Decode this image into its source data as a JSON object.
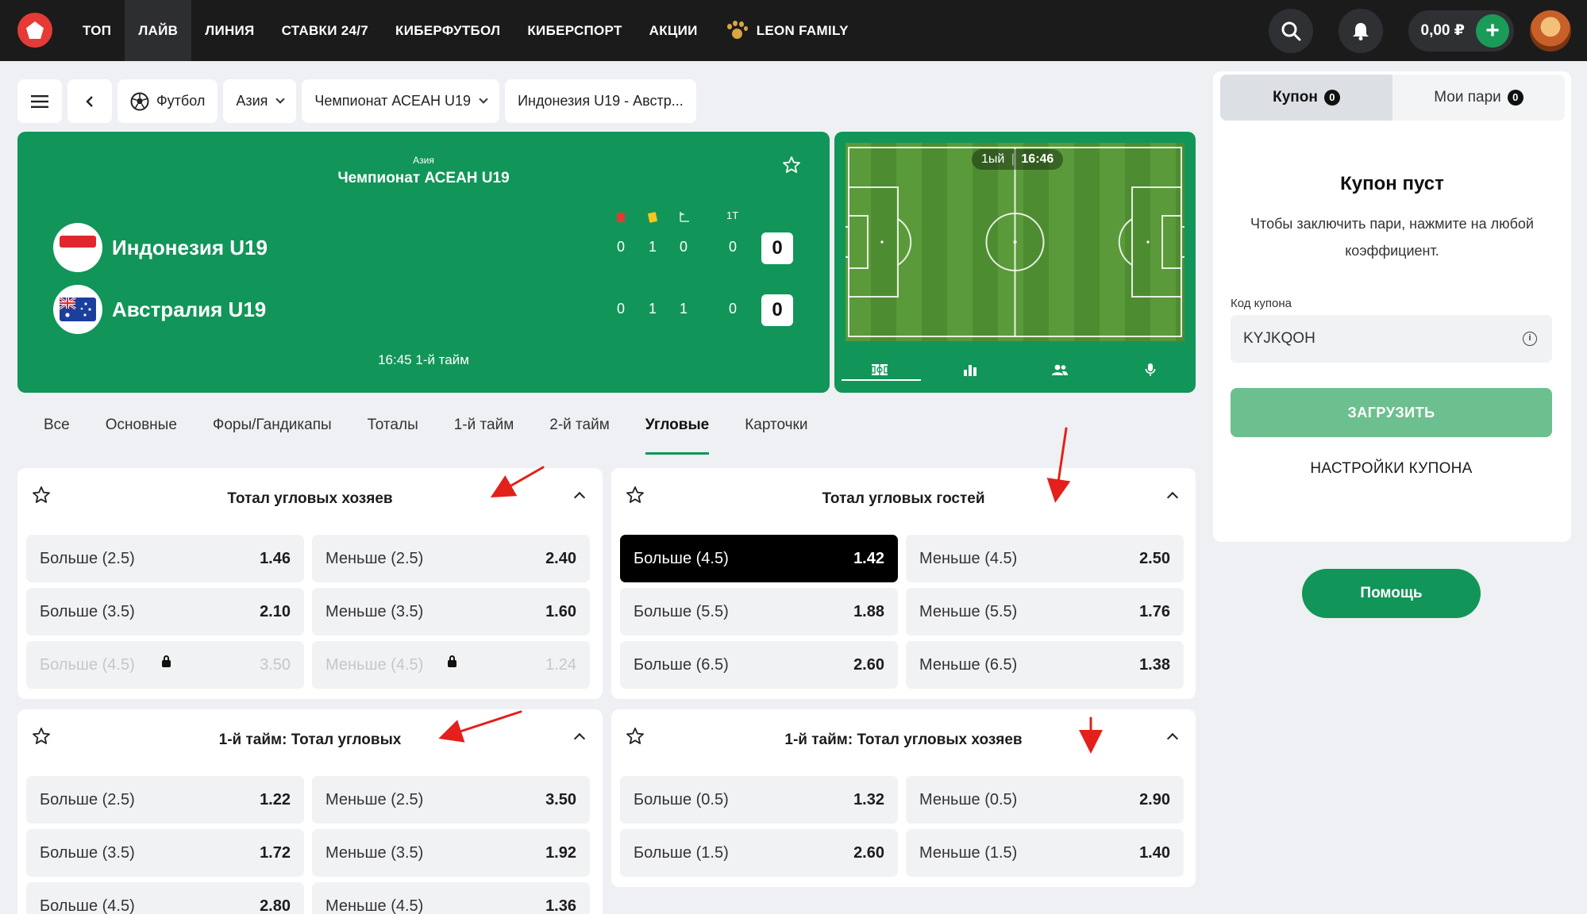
{
  "nav": {
    "items": [
      "ТОП",
      "ЛАЙВ",
      "ЛИНИЯ",
      "СТАВКИ 24/7",
      "КИБЕРФУТБОЛ",
      "КИБЕРСПОРТ",
      "АКЦИИ"
    ],
    "family": "LEON FAMILY",
    "balance": "0,00 ₽"
  },
  "breadcrumb": {
    "sport": "Футбол",
    "region": "Азия",
    "league": "Чемпионат АСЕАН U19",
    "match": "Индонезия U19 - Австр..."
  },
  "match": {
    "region": "Азия",
    "league": "Чемпионат АСЕАН U19",
    "stat_half_label": "1Т",
    "home": {
      "name": "Индонезия U19",
      "red": "0",
      "yellow": "1",
      "corners": "0",
      "half": "0",
      "total": "0"
    },
    "away": {
      "name": "Австралия U19",
      "red": "0",
      "yellow": "1",
      "corners": "1",
      "half": "0",
      "total": "0"
    },
    "time": "16:45 1-й тайм"
  },
  "pitch": {
    "period": "1ый",
    "clock": "16:46"
  },
  "market_tabs": [
    "Все",
    "Основные",
    "Форы/Гандикапы",
    "Тоталы",
    "1-й тайм",
    "2-й тайм",
    "Угловые",
    "Карточки"
  ],
  "markets": [
    {
      "title": "Тотал угловых хозяев",
      "rows": [
        {
          "over": "Больше (2.5)",
          "over_odd": "1.46",
          "under": "Меньше (2.5)",
          "under_odd": "2.40"
        },
        {
          "over": "Больше (3.5)",
          "over_odd": "2.10",
          "under": "Меньше (3.5)",
          "under_odd": "1.60"
        },
        {
          "over": "Больше (4.5)",
          "over_odd": "3.50",
          "under": "Меньше (4.5)",
          "under_odd": "1.24"
        }
      ]
    },
    {
      "title": "Тотал угловых гостей",
      "rows": [
        {
          "over": "Больше (4.5)",
          "over_odd": "1.42",
          "under": "Меньше (4.5)",
          "under_odd": "2.50"
        },
        {
          "over": "Больше (5.5)",
          "over_odd": "1.88",
          "under": "Меньше (5.5)",
          "under_odd": "1.76"
        },
        {
          "over": "Больше (6.5)",
          "over_odd": "2.60",
          "under": "Меньше (6.5)",
          "under_odd": "1.38"
        }
      ]
    },
    {
      "title": "1-й тайм: Тотал угловых",
      "rows": [
        {
          "over": "Больше (2.5)",
          "over_odd": "1.22",
          "under": "Меньше (2.5)",
          "under_odd": "3.50"
        },
        {
          "over": "Больше (3.5)",
          "over_odd": "1.72",
          "under": "Меньше (3.5)",
          "under_odd": "1.92"
        },
        {
          "over": "Больше (4.5)",
          "over_odd": "2.80",
          "under": "Меньше (4.5)",
          "under_odd": "1.36"
        }
      ]
    },
    {
      "title": "1-й тайм: Тотал угловых хозяев",
      "rows": [
        {
          "over": "Больше (0.5)",
          "over_odd": "1.32",
          "under": "Меньше (0.5)",
          "under_odd": "2.90"
        },
        {
          "over": "Больше (1.5)",
          "over_odd": "2.60",
          "under": "Меньше (1.5)",
          "under_odd": "1.40"
        }
      ]
    }
  ],
  "coupon": {
    "tab_coupon": "Купон",
    "tab_coupon_count": "0",
    "tab_bets": "Мои пари",
    "tab_bets_count": "0",
    "empty_title": "Купон пуст",
    "empty_hint": "Чтобы заключить пари, нажмите на любой коэффициент.",
    "code_label": "Код купона",
    "code_value": "KYJKQOH",
    "load_button": "ЗАГРУЗИТЬ",
    "settings": "НАСТРОЙКИ КУПОНА"
  },
  "help_button": "Помощь",
  "colors": {
    "brand_green": "#129559",
    "nav_bg": "#1b1b1c",
    "accent_red": "#e63a36",
    "annotation_red": "#e3201b"
  }
}
